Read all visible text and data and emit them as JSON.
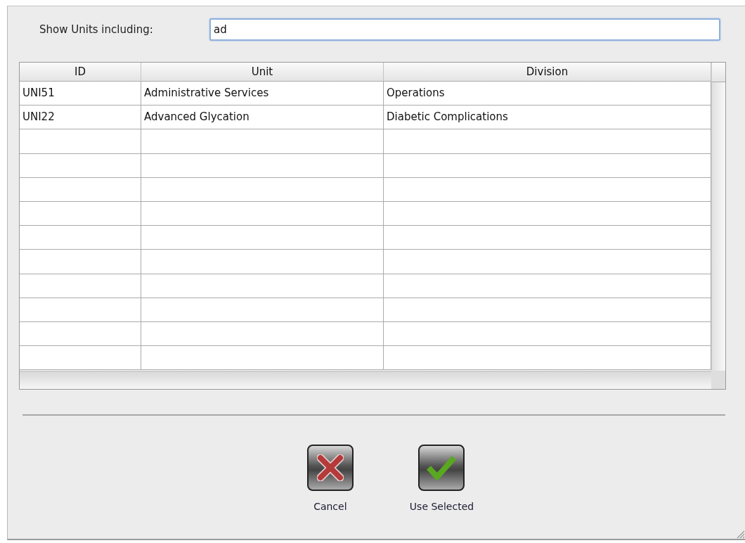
{
  "filter": {
    "label": "Show Units including:",
    "value": "ad"
  },
  "table": {
    "columns": [
      "ID",
      "Unit",
      "Division"
    ],
    "rows": [
      {
        "cells": [
          "UNI51",
          "Administrative Services",
          "Operations"
        ]
      },
      {
        "cells": [
          "UNI22",
          "Advanced Glycation",
          "Diabetic Complications"
        ]
      }
    ]
  },
  "buttons": [
    {
      "kind": "cancel",
      "label": "Cancel"
    },
    {
      "kind": "confirm",
      "label": "Use Selected"
    }
  ]
}
